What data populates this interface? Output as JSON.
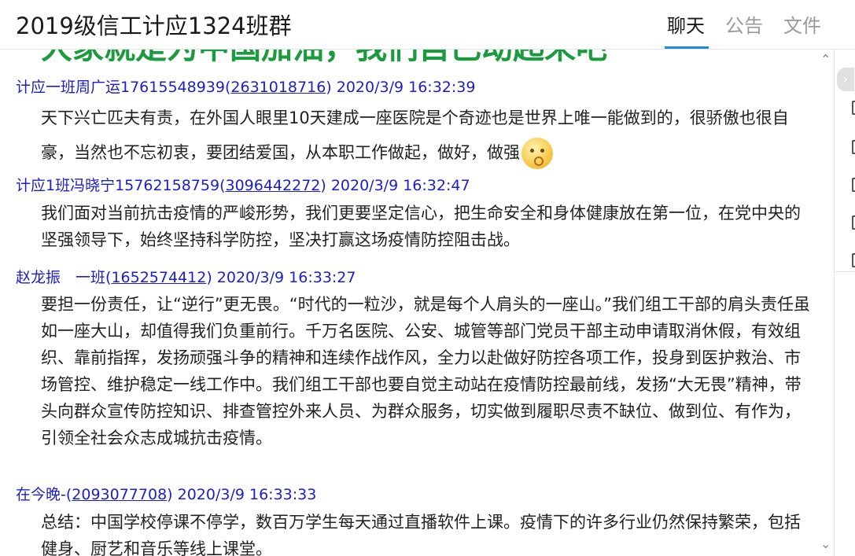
{
  "header": {
    "title": "2019级信工计应1324班群",
    "tabs": [
      {
        "label": "聊天",
        "active": true
      },
      {
        "label": "公告",
        "active": false
      },
      {
        "label": "文件",
        "active": false
      }
    ]
  },
  "banner": {
    "text": "大家就是为中国加油，我们自己动起来吧"
  },
  "messages": [
    {
      "sender": "计应一班周广运17615548939",
      "qq": "2631018716",
      "time": "2020/3/9 16:32:39",
      "body": "天下兴亡匹夫有责，在外国人眼里10天建成一座医院是个奇迹也是世界上唯一能做到的，很骄傲也很自豪，当然也不忘初衷，要团结爱国，从本职工作做起，做好，做强",
      "emoji": "emoji-face-icon"
    },
    {
      "sender": "计应1班冯晓宁15762158759",
      "qq": "3096442272",
      "time": "2020/3/9 16:32:47",
      "body": "我们面对当前抗击疫情的严峻形势，我们更要坚定信心，把生命安全和身体健康放在第一位，在党中央的坚强领导下，始终坚持科学防控，坚决打赢这场疫情防控阻击战。"
    },
    {
      "sender": "赵龙振　一班",
      "qq": "1652574412",
      "time": "2020/3/9 16:33:27",
      "body": "要担一份责任，让“逆行”更无畏。“时代的一粒沙，就是每个人肩头的一座山。”我们组工干部的肩头责任虽如一座大山，却值得我们负重前行。千万名医院、公安、城管等部门党员干部主动申请取消休假，有效组织、靠前指挥，发扬顽强斗争的精神和连续作战作风，全力以赴做好防控各项工作，投身到医护救治、市场管控、维护稳定一线工作中。我们组工干部也要自觉主动站在疫情防控最前线，发扬“大无畏”精神，带头向群众宣传防控知识、排查管控外来人员、为群众服务，切实做到履职尽责不缺位、做到位、有作为，引领全社会众志成城抗击疫情。"
    },
    {
      "sender": "在今晚-",
      "qq": "2093077708",
      "time": "2020/3/9 16:33:33",
      "body": "总结：中国学校停课不停学，数百万学生每天通过直播软件上课。疫情下的许多行业仍然保持繁荣，包括健身、厨艺和音乐等线上课堂。"
    }
  ],
  "scrollbar": {
    "up_icon": "chevron-up-icon",
    "down_icon": "chevron-down-icon"
  },
  "sidebar": {
    "toggle_icon": "chevron-right-icon"
  },
  "colors": {
    "accent": "#1e88e5",
    "sender": "#1a1fc9",
    "banner": "#1a9c3e"
  }
}
